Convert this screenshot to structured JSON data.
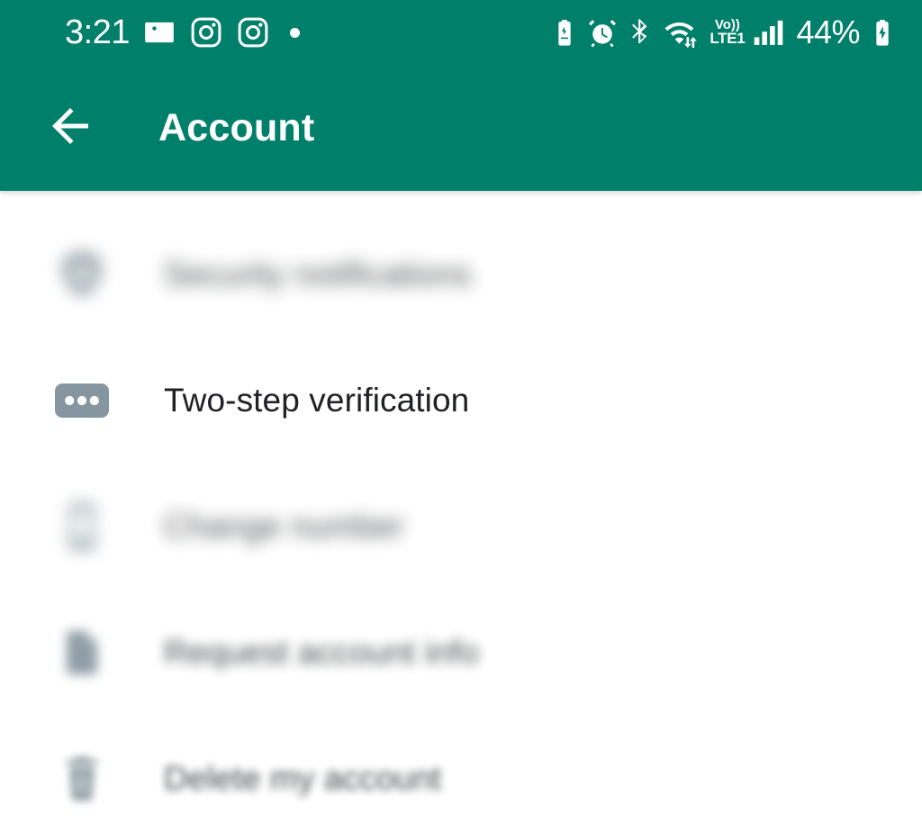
{
  "status_bar": {
    "time": "3:21",
    "battery_percent": "44%",
    "left_icons": [
      {
        "name": "photo-gallery-icon",
        "label": "Gallery"
      },
      {
        "name": "instagram-icon-1",
        "label": "Instagram"
      },
      {
        "name": "instagram-icon-2",
        "label": "Instagram"
      },
      {
        "name": "notification-dot-icon",
        "label": "More notifications"
      }
    ],
    "right_icons": [
      {
        "name": "battery-saver-icon",
        "label": "Battery saver"
      },
      {
        "name": "alarm-clock-icon",
        "label": "Alarm set"
      },
      {
        "name": "bluetooth-icon",
        "label": "Bluetooth on"
      },
      {
        "name": "wifi-data-transfer-icon",
        "label": "Wi-Fi"
      },
      {
        "name": "volte-icon",
        "label": "VoLTE"
      },
      {
        "name": "signal-bars-icon",
        "label": "Mobile signal"
      },
      {
        "name": "battery-charging-icon",
        "label": "Charging"
      }
    ],
    "volte_top": "Vo))",
    "volte_bottom": "LTE1"
  },
  "app_bar": {
    "back_label": "Back",
    "title": "Account"
  },
  "settings_list": {
    "rows": [
      {
        "label": "Security notifications",
        "icon": "shield-lock-icon",
        "blur": "blur-heavy"
      },
      {
        "label": "Two-step verification",
        "icon": "three-dots-pin-icon",
        "blur": "blur-none"
      },
      {
        "label": "Change number",
        "icon": "phone-icon",
        "blur": "blur-strong"
      },
      {
        "label": "Request account info",
        "icon": "document-info-icon",
        "blur": "blur-mid"
      },
      {
        "label": "Delete my account",
        "icon": "trash-delete-icon",
        "blur": "blur-light"
      }
    ]
  },
  "colors": {
    "header_green": "#00806a",
    "icon_gray": "#8696a0",
    "text_primary": "#202124",
    "background": "#ffffff"
  }
}
